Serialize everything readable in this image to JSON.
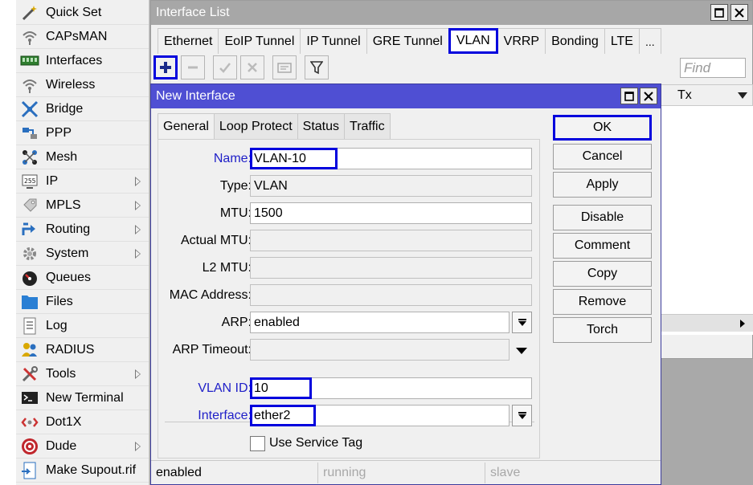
{
  "sidebar": {
    "items": [
      {
        "label": "Quick Set",
        "icon": "wand-icon",
        "submenu": false
      },
      {
        "label": "CAPsMAN",
        "icon": "wifi-signal-icon",
        "submenu": false
      },
      {
        "label": "Interfaces",
        "icon": "network-card-icon",
        "submenu": false
      },
      {
        "label": "Wireless",
        "icon": "wifi-signal-icon",
        "submenu": false
      },
      {
        "label": "Bridge",
        "icon": "bridge-icon",
        "submenu": false
      },
      {
        "label": "PPP",
        "icon": "ppp-icon",
        "submenu": false
      },
      {
        "label": "Mesh",
        "icon": "mesh-icon",
        "submenu": false
      },
      {
        "label": "IP",
        "icon": "ip-icon",
        "submenu": true
      },
      {
        "label": "MPLS",
        "icon": "mpls-icon",
        "submenu": true
      },
      {
        "label": "Routing",
        "icon": "routing-icon",
        "submenu": true
      },
      {
        "label": "System",
        "icon": "gear-icon",
        "submenu": true
      },
      {
        "label": "Queues",
        "icon": "queues-icon",
        "submenu": false
      },
      {
        "label": "Files",
        "icon": "folder-icon",
        "submenu": false
      },
      {
        "label": "Log",
        "icon": "log-icon",
        "submenu": false
      },
      {
        "label": "RADIUS",
        "icon": "radius-users-icon",
        "submenu": false
      },
      {
        "label": "Tools",
        "icon": "tools-icon",
        "submenu": true
      },
      {
        "label": "New Terminal",
        "icon": "terminal-icon",
        "submenu": false
      },
      {
        "label": "Dot1X",
        "icon": "dot1x-icon",
        "submenu": false
      },
      {
        "label": "Dude",
        "icon": "dude-icon",
        "submenu": true
      },
      {
        "label": "Make Supout.rif",
        "icon": "supout-icon",
        "submenu": false
      }
    ]
  },
  "interface_list": {
    "title": "Interface List",
    "tabs": [
      "Ethernet",
      "EoIP Tunnel",
      "IP Tunnel",
      "GRE Tunnel",
      "VLAN",
      "VRRP",
      "Bonding",
      "LTE",
      "..."
    ],
    "active_tab": "VLAN",
    "find_placeholder": "Find",
    "column_tx": "Tx"
  },
  "dialog": {
    "title": "New Interface",
    "tabs": [
      "General",
      "Loop Protect",
      "Status",
      "Traffic"
    ],
    "active_tab": "General",
    "fields": {
      "name": {
        "label": "Name:",
        "value": "VLAN-10"
      },
      "type": {
        "label": "Type:",
        "value": "VLAN"
      },
      "mtu": {
        "label": "MTU:",
        "value": "1500"
      },
      "actual_mtu": {
        "label": "Actual MTU:",
        "value": ""
      },
      "l2_mtu": {
        "label": "L2 MTU:",
        "value": ""
      },
      "mac_address": {
        "label": "MAC Address:",
        "value": ""
      },
      "arp": {
        "label": "ARP:",
        "value": "enabled"
      },
      "arp_timeout": {
        "label": "ARP Timeout:",
        "value": ""
      },
      "vlan_id": {
        "label": "VLAN ID:",
        "value": "10"
      },
      "interface": {
        "label": "Interface:",
        "value": "ether2"
      },
      "use_service_tag": {
        "label": "Use Service Tag",
        "checked": false
      }
    },
    "buttons": {
      "ok": "OK",
      "cancel": "Cancel",
      "apply": "Apply",
      "disable": "Disable",
      "comment": "Comment",
      "copy": "Copy",
      "remove": "Remove",
      "torch": "Torch"
    },
    "status": {
      "state": "enabled",
      "running": "running",
      "slave": "slave"
    }
  },
  "colors": {
    "highlight": "#0000dd",
    "dialog_title": "#4f4fd3",
    "blue_label": "#2020c8"
  }
}
